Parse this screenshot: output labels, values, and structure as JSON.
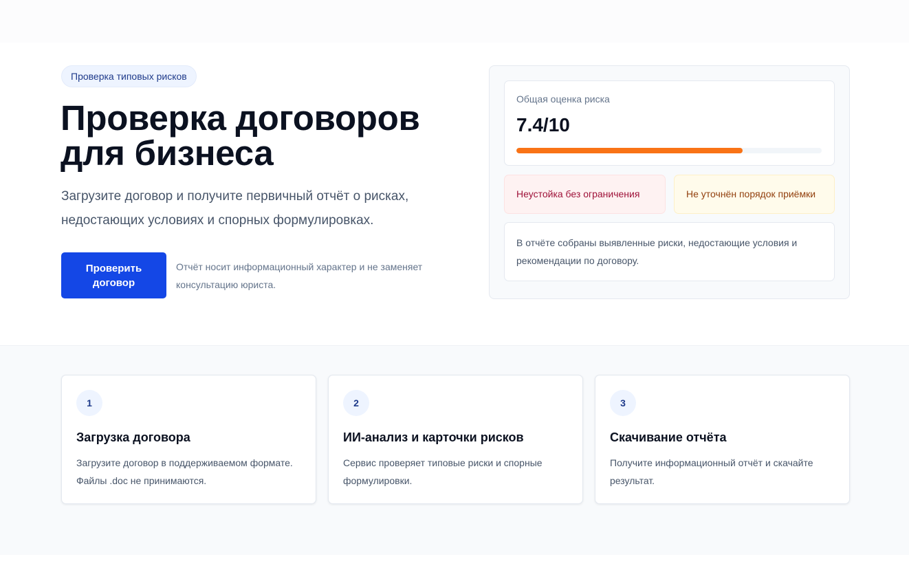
{
  "hero": {
    "badge": "Проверка типовых рисков",
    "title": "Проверка договоров для бизнеса",
    "subtitle": "Загрузите договор и получите первичный отчёт о рисках, недостающих условиях и спорных формулировках.",
    "cta_label": "Проверить договор",
    "disclaimer": "Отчёт носит информационный характер и не заменяет консультацию юриста."
  },
  "report": {
    "score_label": "Общая оценка риска",
    "score_value": "7.4/10",
    "score_fraction": 0.74,
    "risk_chips": [
      {
        "label": "Неустойка без ограничения",
        "color": "#9f1239"
      },
      {
        "label": "Не уточнён порядок приёмки",
        "color": "#92400e"
      }
    ],
    "note": "В отчёте собраны выявленные риски, недостающие условия и рекомендации по договору.",
    "accent_color": "#f97316"
  },
  "steps": [
    {
      "number": "1",
      "title": "Загрузка договора",
      "description": "Загрузите договор в поддерживаемом формате. Файлы .doc не принимаются."
    },
    {
      "number": "2",
      "title": "ИИ-анализ и карточки рисков",
      "description": "Сервис проверяет типовые риски и спорные формулировки."
    },
    {
      "number": "3",
      "title": "Скачивание отчёта",
      "description": "Получите информационный отчёт и скачайте результат."
    }
  ],
  "colors": {
    "brand": "#1447e6",
    "heading": "#0b1120",
    "muted": "#475569"
  }
}
